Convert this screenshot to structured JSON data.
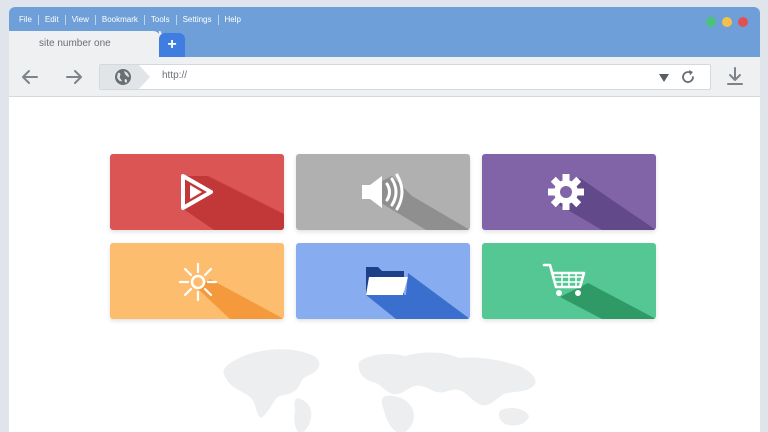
{
  "menu": [
    "File",
    "Edit",
    "View",
    "Bookmark",
    "Tools",
    "Settings",
    "Help"
  ],
  "window_controls": [
    {
      "name": "minimize",
      "color": "#4bc27a"
    },
    {
      "name": "maximize",
      "color": "#f3c04a"
    },
    {
      "name": "close",
      "color": "#e05252"
    }
  ],
  "tab": {
    "title": "site number one",
    "new_tab_label": "+"
  },
  "toolbar": {
    "back_icon": "arrow-left-icon",
    "forward_icon": "arrow-right-icon",
    "address_value": "http://",
    "dropdown_icon": "dropdown-triangle-icon",
    "reload_icon": "reload-icon",
    "download_icon": "download-icon"
  },
  "tiles": [
    {
      "name": "video",
      "icon": "play-icon",
      "color": "#db5555"
    },
    {
      "name": "audio",
      "icon": "speaker-icon",
      "color": "#b0b0b0"
    },
    {
      "name": "settings",
      "icon": "gear-icon",
      "color": "#8163a8"
    },
    {
      "name": "brightness",
      "icon": "sun-icon",
      "color": "#fdbd6e"
    },
    {
      "name": "files",
      "icon": "folder-icon",
      "color": "#87acef"
    },
    {
      "name": "shop",
      "icon": "cart-icon",
      "color": "#55c795"
    }
  ]
}
